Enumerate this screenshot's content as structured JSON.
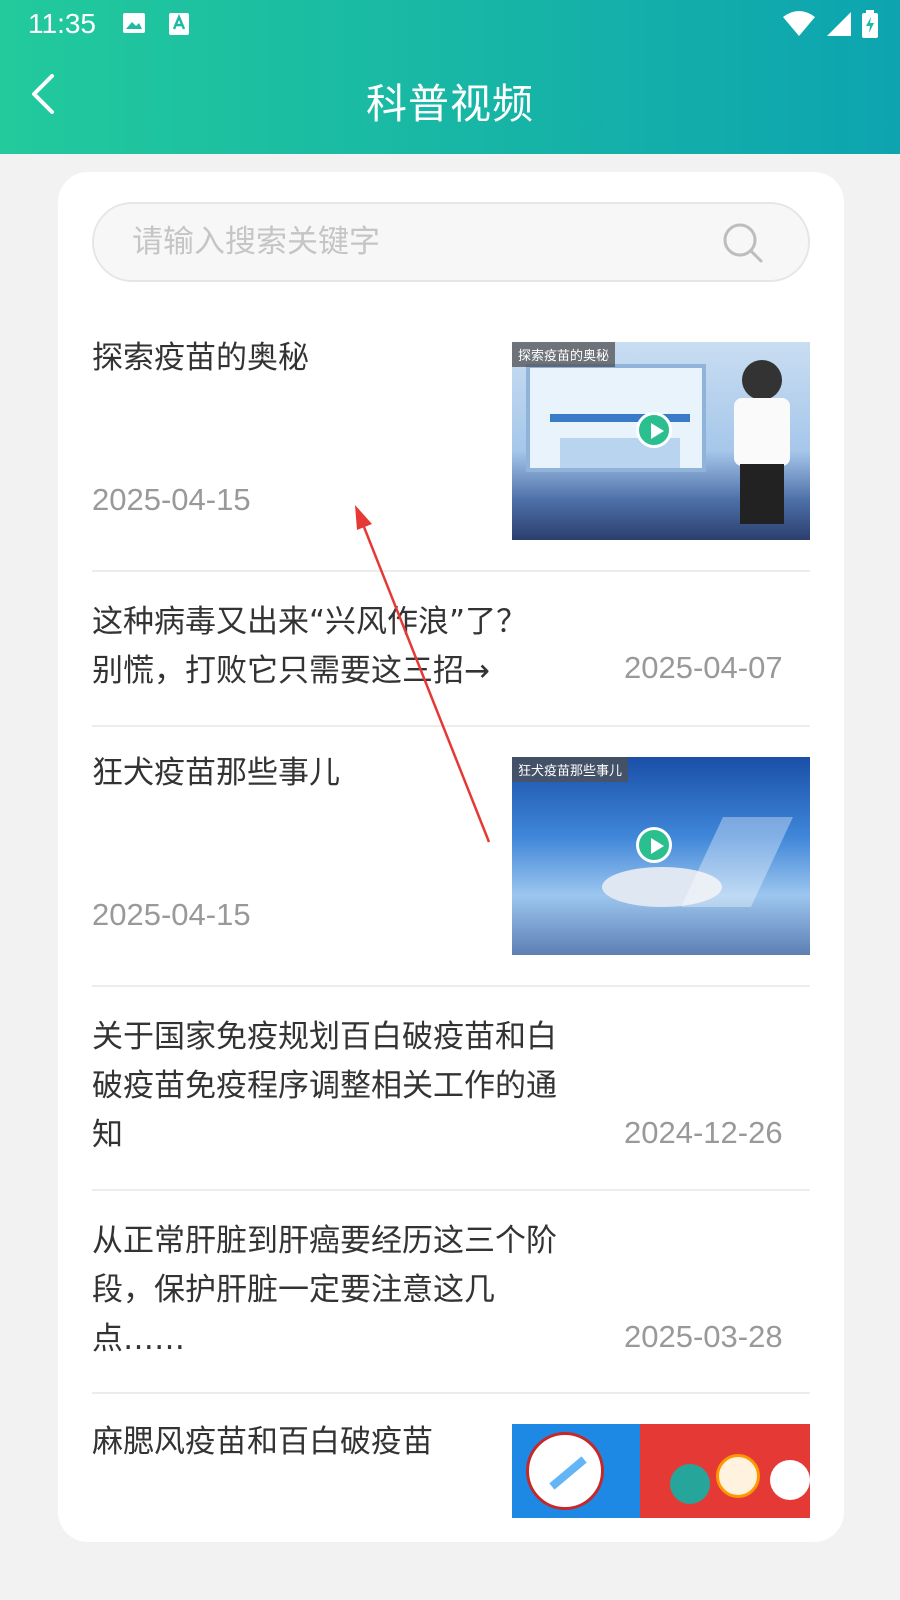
{
  "status_bar": {
    "time": "11:35"
  },
  "header": {
    "title": "科普视频"
  },
  "search": {
    "placeholder": "请输入搜索关键字"
  },
  "items": [
    {
      "title": "探索疫苗的奥秘",
      "date": "2025-04-15",
      "thumb_caption": "探索疫苗的奥秘",
      "has_video": true
    },
    {
      "title": "这种病毒又出来“兴风作浪”了？别慌，打败它只需要这三招→",
      "date": "2025-04-07"
    },
    {
      "title": "狂犬疫苗那些事儿",
      "date": "2025-04-15",
      "thumb_caption": "狂犬疫苗那些事儿",
      "has_video": true
    },
    {
      "title": "关于国家免疫规划百白破疫苗和白破疫苗免疫程序调整相关工作的通知",
      "date": "2024-12-26"
    },
    {
      "title": "从正常肝脏到肝癌要经历这三个阶段，保护肝脏一定要注意这几点……",
      "date": "2025-03-28"
    },
    {
      "title": "麻腮风疫苗和百白破疫苗"
    }
  ],
  "colors": {
    "header_start": "#22ca9c",
    "header_end": "#0da4b0",
    "annotation_arrow": "#e53935"
  }
}
